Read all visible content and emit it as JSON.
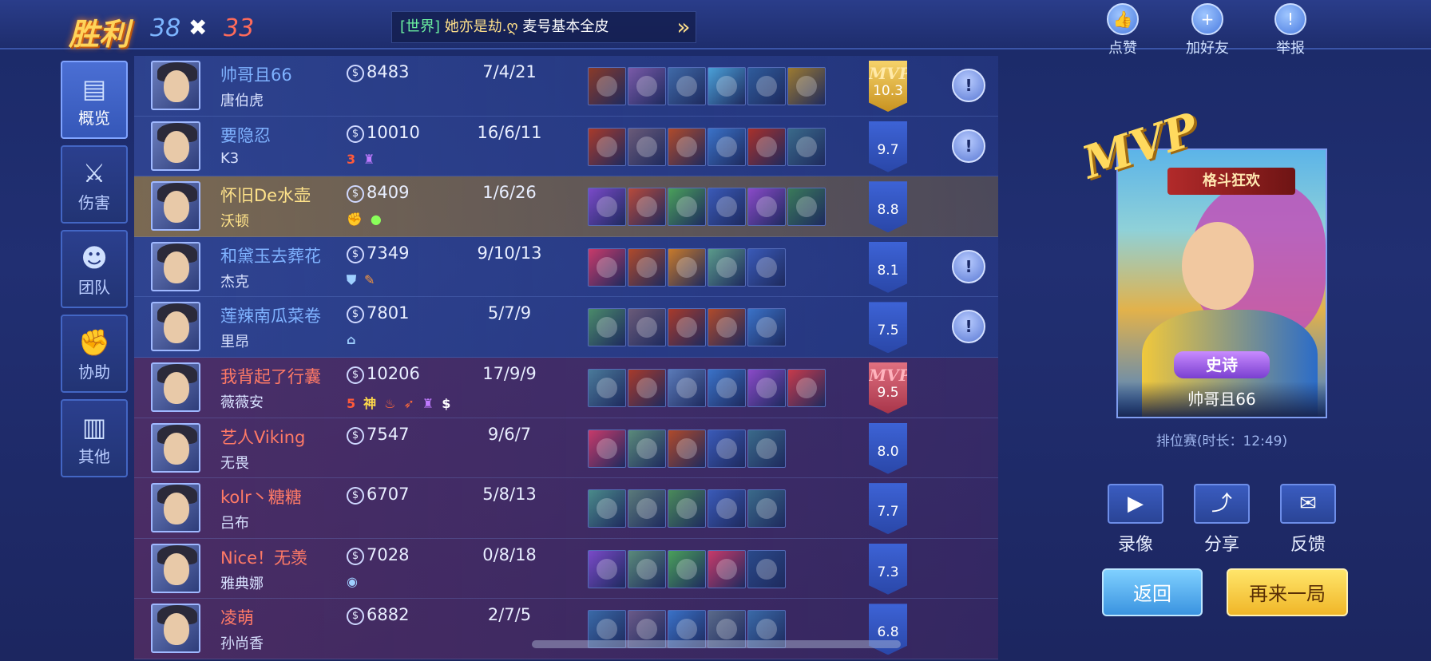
{
  "header": {
    "result": "胜利",
    "blue_kills": "38",
    "vs_icon": "✖",
    "red_kills": "33",
    "broadcast_tag": "[世界]",
    "broadcast_name": "她亦是劫.ღ",
    "broadcast_msg": "麦号基本全皮",
    "broadcast_arrow": "»",
    "actions": [
      {
        "label": "点赞",
        "icon": "thumbs-up-icon",
        "glyph": "👍"
      },
      {
        "label": "加好友",
        "icon": "add-friend-icon",
        "glyph": "+"
      },
      {
        "label": "举报",
        "icon": "report-icon",
        "glyph": "!"
      }
    ]
  },
  "tabs": [
    {
      "label": "概览",
      "icon": "overview-icon",
      "glyph": "▤"
    },
    {
      "label": "伤害",
      "icon": "sword-icon",
      "glyph": "⚔"
    },
    {
      "label": "团队",
      "icon": "team-icon",
      "glyph": "☻"
    },
    {
      "label": "协助",
      "icon": "fist-icon",
      "glyph": "✊"
    },
    {
      "label": "其他",
      "icon": "bar-chart-icon",
      "glyph": "▥"
    }
  ],
  "players": [
    {
      "name": "帅哥且66",
      "hero": "唐伯虎",
      "gold": "8483",
      "kda": "7/4/21",
      "rating": "10.3",
      "mvp": "MVP",
      "team": "blue",
      "badges": [],
      "report": true,
      "items": [
        "#8a3a28",
        "#7a5aa8",
        "#3f6aa8",
        "#4aa0d8",
        "#2f5c9c",
        "#9c7a30"
      ]
    },
    {
      "name": "要隐忍",
      "hero": "K3",
      "gold": "10010",
      "kda": "16/6/11",
      "rating": "9.7",
      "mvp": "",
      "team": "blue",
      "badges": [
        {
          "t": "3",
          "c": "#ff5a3a"
        },
        {
          "t": "♜",
          "c": "#c07aff"
        }
      ],
      "report": true,
      "items": [
        "#a83a2a",
        "#6a5a78",
        "#b04a2a",
        "#3a72c8",
        "#a8302a",
        "#3a6a8a"
      ]
    },
    {
      "name": "怀旧De水壶",
      "hero": "沃顿",
      "gold": "8409",
      "kda": "1/6/26",
      "rating": "8.8",
      "mvp": "",
      "team": "self",
      "badges": [
        {
          "t": "✊",
          "c": "#8aff5a"
        },
        {
          "t": "●",
          "c": "#8aff5a"
        }
      ],
      "report": false,
      "items": [
        "#7a4ac8",
        "#b84a3a",
        "#4aa05a",
        "#3a5ab8",
        "#8a4ac8",
        "#3a7a5a"
      ]
    },
    {
      "name": "和黛玉去葬花",
      "hero": "杰克",
      "gold": "7349",
      "kda": "9/10/13",
      "rating": "8.1",
      "mvp": "",
      "team": "blue",
      "badges": [
        {
          "t": "⛊",
          "c": "#9fd0ff"
        },
        {
          "t": "✎",
          "c": "#ff9a3a"
        }
      ],
      "report": true,
      "items": [
        "#c83a6a",
        "#b04a2a",
        "#c87a2a",
        "#5a9a8a",
        "#3a5ab8"
      ]
    },
    {
      "name": "莲辣南瓜菜卷",
      "hero": "里昂",
      "gold": "7801",
      "kda": "5/7/9",
      "rating": "7.5",
      "mvp": "",
      "team": "blue",
      "badges": [
        {
          "t": "⌂",
          "c": "#9fd0ff"
        }
      ],
      "report": true,
      "items": [
        "#4a8a6a",
        "#6a5a78",
        "#a83a2a",
        "#b04a2a",
        "#3a72c8"
      ]
    },
    {
      "name": "我背起了行囊",
      "hero": "薇薇安",
      "gold": "10206",
      "kda": "17/9/9",
      "rating": "9.5",
      "mvp": "MVP",
      "team": "red",
      "badges": [
        {
          "t": "5",
          "c": "#ff5a3a"
        },
        {
          "t": "神",
          "c": "#ffd84a"
        },
        {
          "t": "♨",
          "c": "#ff6a3a"
        },
        {
          "t": "➶",
          "c": "#ff6a3a"
        },
        {
          "t": "♜",
          "c": "#c07aff"
        },
        {
          "t": "$",
          "c": "#ffffff"
        }
      ],
      "report": false,
      "items": [
        "#4a7a9a",
        "#a83a2a",
        "#5a7ab8",
        "#3a72c8",
        "#8a4ac8",
        "#c83a4a"
      ]
    },
    {
      "name": "艺人Viking",
      "hero": "无畏",
      "gold": "7547",
      "kda": "9/6/7",
      "rating": "8.0",
      "mvp": "",
      "team": "red",
      "badges": [],
      "report": false,
      "items": [
        "#c83a6a",
        "#5a8a7a",
        "#b04a2a",
        "#3a5ab8",
        "#3a6a8a"
      ]
    },
    {
      "name": "kolr丶糖糖",
      "hero": "吕布",
      "gold": "6707",
      "kda": "5/8/13",
      "rating": "7.7",
      "mvp": "",
      "team": "red",
      "badges": [],
      "report": false,
      "items": [
        "#4a8a8a",
        "#5a7a7a",
        "#4a8a5a",
        "#3a5ab8",
        "#3a6a8a"
      ]
    },
    {
      "name": "Nice！无羡",
      "hero": "雅典娜",
      "gold": "7028",
      "kda": "0/8/18",
      "rating": "7.3",
      "mvp": "",
      "team": "red",
      "badges": [
        {
          "t": "◉",
          "c": "#9fd0ff"
        }
      ],
      "report": false,
      "items": [
        "#7a4ac8",
        "#5a8a7a",
        "#4aa05a",
        "#c83a6a",
        "#2a4a8a"
      ]
    },
    {
      "name": "凌萌",
      "hero": "孙尚香",
      "gold": "6882",
      "kda": "2/7/5",
      "rating": "6.8",
      "mvp": "",
      "team": "red",
      "badges": [],
      "report": false,
      "items": [
        "#3a6aa8",
        "#6a5a88",
        "#3a72c8",
        "#5a6a8a",
        "#3a6aa8"
      ]
    }
  ],
  "mvp_panel": {
    "mvp_text": "MVP",
    "skin_banner": "格斗狂欢",
    "rarity": "史诗",
    "player_name": "帅哥且66",
    "match_info": "排位赛(时长：12:49)"
  },
  "actions": [
    {
      "label": "录像",
      "icon": "video-camera-icon",
      "glyph": "▶"
    },
    {
      "label": "分享",
      "icon": "share-icon",
      "glyph": "⤴"
    },
    {
      "label": "反馈",
      "icon": "feedback-icon",
      "glyph": "✉"
    }
  ],
  "buttons": {
    "back": "返回",
    "again": "再来一局"
  },
  "colors": {
    "accent_gold": "#ffd45a",
    "blue_team": "#7fb2ff",
    "red_team": "#ff7a66"
  }
}
